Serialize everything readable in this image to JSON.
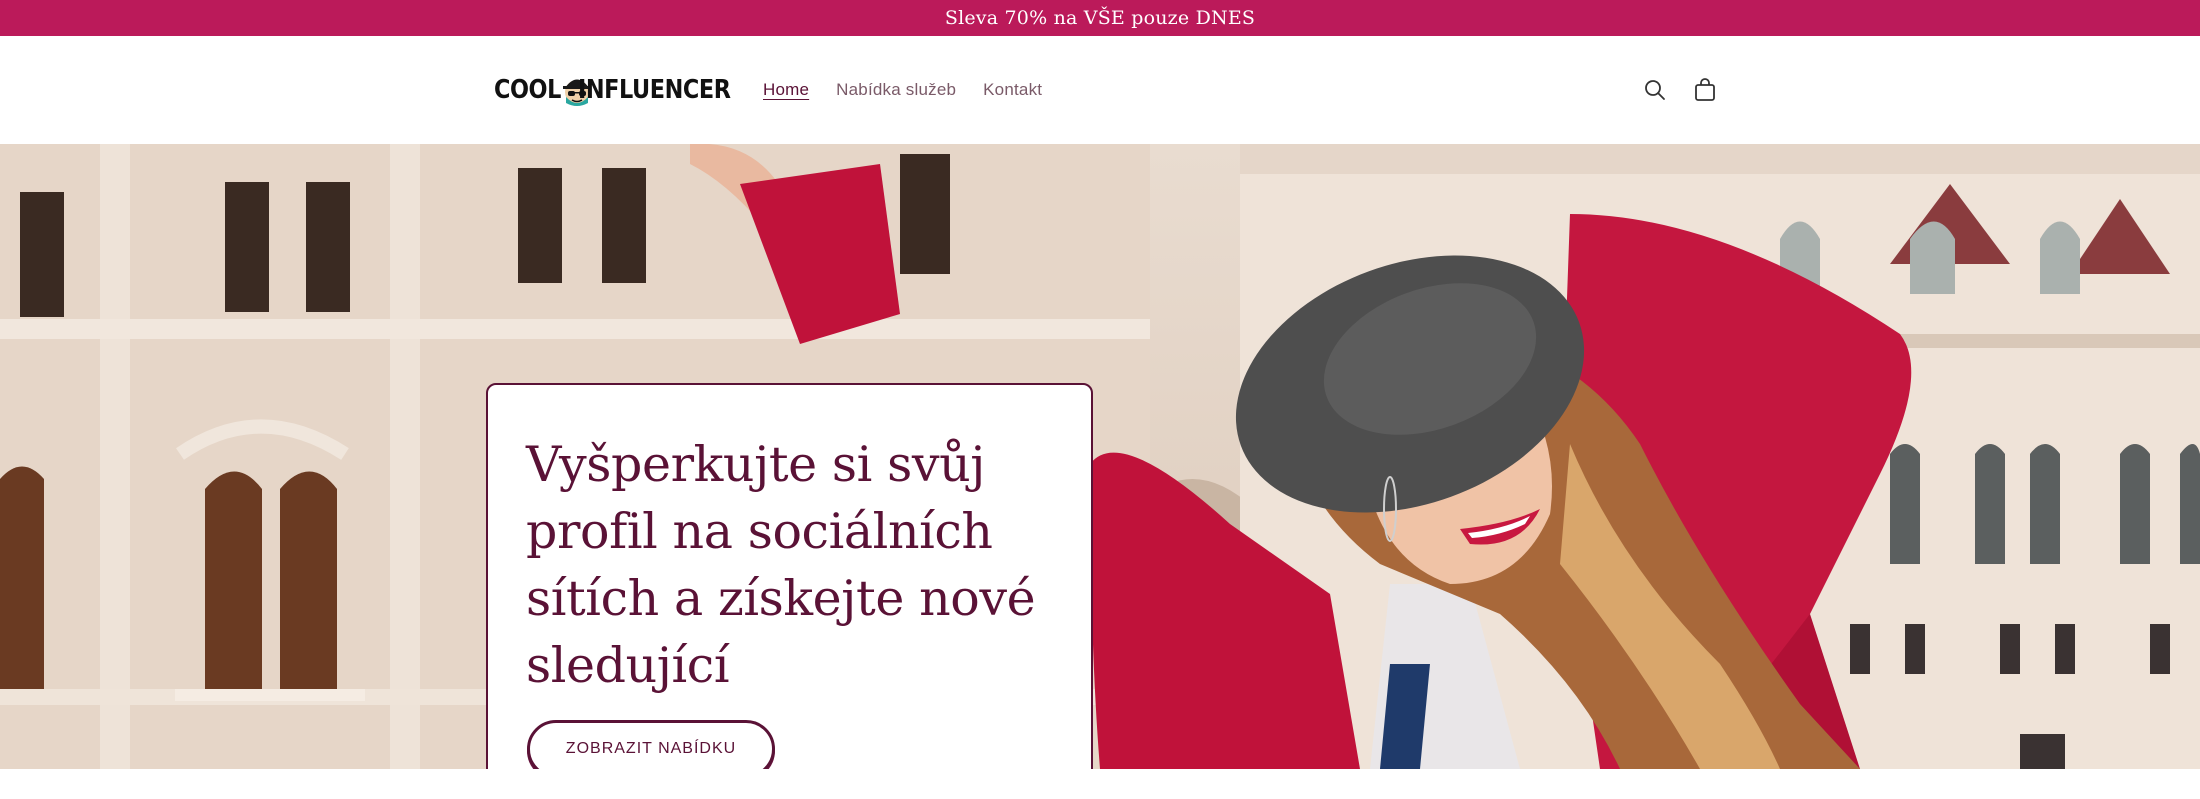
{
  "announcement": {
    "text": "Sleva 70% na VŠE pouze DNES",
    "background": "#bb1a5a"
  },
  "header": {
    "logo": {
      "part1": "COOL",
      "part2": "INFLUENCER"
    },
    "nav": [
      {
        "label": "Home",
        "active": true
      },
      {
        "label": "Nabídka služeb",
        "active": false
      },
      {
        "label": "Kontakt",
        "active": false
      }
    ],
    "icons": [
      "search-icon",
      "cart-icon"
    ]
  },
  "hero": {
    "title": "Vyšperkujte si svůj profil na sociálních sítích a získejte nové sledující",
    "button_label": "ZOBRAZIT NABÍDKU",
    "accent": "#5a1236",
    "jacket_color": "#c0123a"
  }
}
